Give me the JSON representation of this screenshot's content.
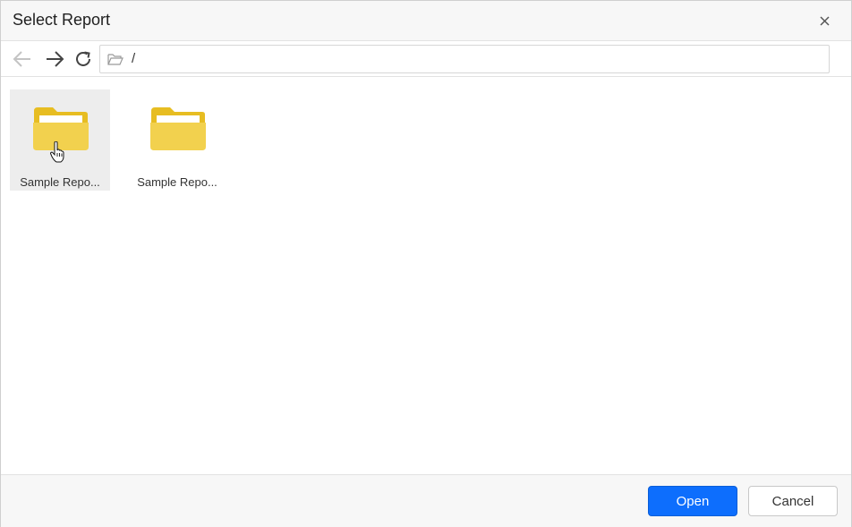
{
  "dialog": {
    "title": "Select Report"
  },
  "toolbar": {
    "path": "/"
  },
  "items": [
    {
      "label": "Sample Repo...",
      "selected": true
    },
    {
      "label": "Sample Repo...",
      "selected": false
    }
  ],
  "footer": {
    "open_label": "Open",
    "cancel_label": "Cancel"
  },
  "colors": {
    "accent": "#0d6efd",
    "folder": "#f2d14e",
    "folder_tab": "#e7bd22"
  }
}
